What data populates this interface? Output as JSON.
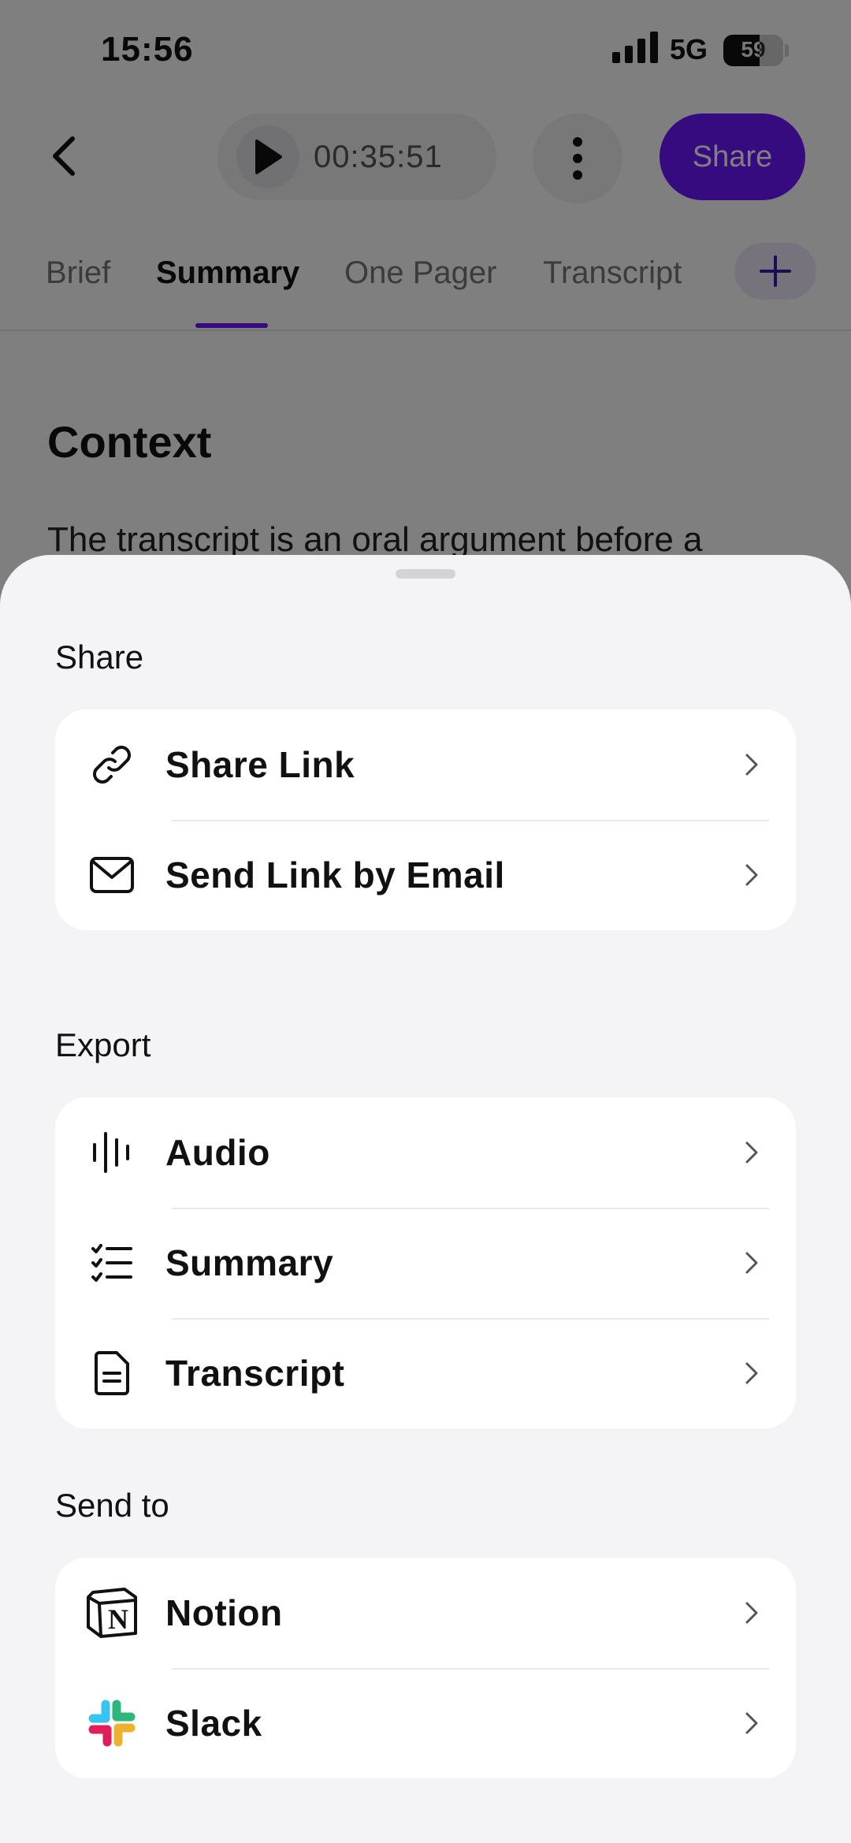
{
  "status_bar": {
    "time": "15:56",
    "network": "5G",
    "battery": "59"
  },
  "player": {
    "time": "00:35:51"
  },
  "header": {
    "share_label": "Share"
  },
  "tabs": [
    {
      "label": "Brief"
    },
    {
      "label": "Summary",
      "active": true
    },
    {
      "label": "One Pager"
    },
    {
      "label": "Transcript"
    }
  ],
  "content": {
    "heading": "Context",
    "body": "The transcript is an oral argument before a"
  },
  "sheet": {
    "share": {
      "title": "Share",
      "items": [
        {
          "label": "Share Link",
          "icon": "link-icon"
        },
        {
          "label": "Send Link by Email",
          "icon": "mail-icon"
        }
      ]
    },
    "export": {
      "title": "Export",
      "items": [
        {
          "label": "Audio",
          "icon": "audio-waveform-icon"
        },
        {
          "label": "Summary",
          "icon": "checklist-icon"
        },
        {
          "label": "Transcript",
          "icon": "document-icon"
        }
      ]
    },
    "send_to": {
      "title": "Send to",
      "items": [
        {
          "label": "Notion",
          "icon": "notion-logo-icon"
        },
        {
          "label": "Slack",
          "icon": "slack-logo-icon"
        }
      ]
    }
  },
  "colors": {
    "accent": "#6b16ff",
    "sheet_bg": "#f4f4f6",
    "card_bg": "#ffffff"
  }
}
